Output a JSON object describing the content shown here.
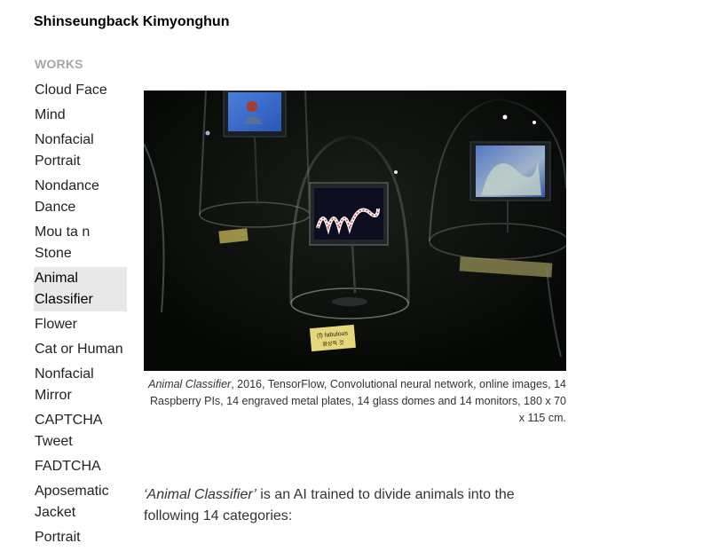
{
  "site": {
    "title": "Shinseungback Kimyonghun"
  },
  "nav": {
    "heading": "WORKS",
    "items": [
      {
        "id": "cloud-face",
        "lines": [
          "Cloud Face"
        ]
      },
      {
        "id": "mind",
        "lines": [
          "Mind"
        ]
      },
      {
        "id": "nonfacial-portrait",
        "lines": [
          "Nonfacial",
          "Portrait"
        ]
      },
      {
        "id": "nondance-dance",
        "lines": [
          "Nondance",
          "Dance"
        ]
      },
      {
        "id": "mou-ta-n-stone",
        "lines": [
          "Mou ta n",
          "Stone"
        ]
      },
      {
        "id": "animal-classifier",
        "lines": [
          "Animal",
          "Classifier"
        ],
        "active": true
      },
      {
        "id": "flower",
        "lines": [
          "Flower"
        ]
      },
      {
        "id": "cat-or-human",
        "lines": [
          "Cat or Human"
        ]
      },
      {
        "id": "nonfacial-mirror",
        "lines": [
          "Nonfacial",
          "Mirror"
        ]
      },
      {
        "id": "captcha-tweet",
        "lines": [
          "CAPTCHA",
          "Tweet"
        ]
      },
      {
        "id": "fadtcha",
        "lines": [
          "FADTCHA"
        ]
      },
      {
        "id": "aposematic-jacket",
        "lines": [
          "Aposematic",
          "Jacket"
        ]
      },
      {
        "id": "portrait",
        "lines": [
          "Portrait"
        ]
      }
    ]
  },
  "artwork": {
    "title": "Animal Classifier",
    "caption_rest": ", 2016, TensorFlow, Convolutional neural network, online images, 14 Raspberry PIs, 14 engraved metal plates, 14 glass domes and 14 monitors, 180 x 70 x 115 cm.",
    "plate_label": "(f)  fabulous",
    "plate_sublabel": "환상적 것"
  },
  "description": {
    "title_quoted": "‘Animal Classifier’",
    "text": " is an AI trained to divide animals into the following 14 categories:"
  },
  "colors": {
    "active_bg": "#e8e8e8",
    "heading": "#a6a6a6",
    "photo_bg": "#0b0d0b",
    "plate": "#e6d77a"
  }
}
